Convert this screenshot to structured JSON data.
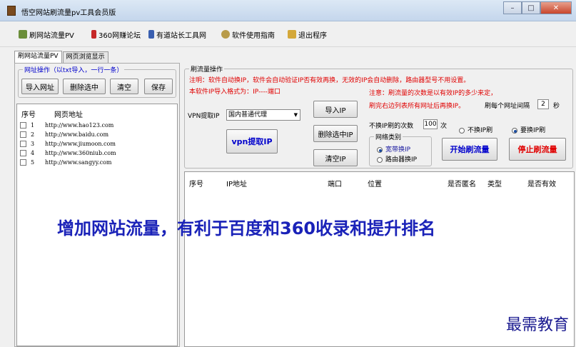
{
  "window": {
    "title": "悟空网站刷流量pv工具会员版"
  },
  "toolbar": {
    "items": [
      {
        "label": "刷网站流量PV",
        "icon": "person-icon"
      },
      {
        "label": "360网赚论坛",
        "icon": "book-icon"
      },
      {
        "label": "有道站长工具网",
        "icon": "chart-icon"
      },
      {
        "label": "软件使用指南",
        "icon": "help-icon"
      },
      {
        "label": "退出程序",
        "icon": "exit-icon"
      }
    ]
  },
  "tabs": [
    "刷网站流量PV",
    "网页浏览显示"
  ],
  "url_group": {
    "title": "网址操作（以txt导入，一行一条）",
    "buttons": [
      "导入网址",
      "删除选中",
      "清空",
      "保存"
    ]
  },
  "url_list": {
    "headers": [
      "序号",
      "网页地址"
    ],
    "rows": [
      {
        "n": "1",
        "url": "http://www.hao123.com"
      },
      {
        "n": "2",
        "url": "http://www.baidu.com"
      },
      {
        "n": "3",
        "url": "http://www.jiumoon.com"
      },
      {
        "n": "4",
        "url": "http://www.360niub.com"
      },
      {
        "n": "5",
        "url": "http://www.sangyy.com"
      }
    ]
  },
  "flow": {
    "title": "刷流量操作",
    "note1": "注明：软件自动换IP，软件会自动验证IP否有效再换，无效的IP会自动删除，路由器型号不用设置。",
    "note2": "本软件IP导入格式为：IP----端口",
    "note3": "注意：刷流量的次数是以有效IP的多少来定，",
    "note4": "刷完右边列表所有网址后再换IP。",
    "interval_label": "刷每个网址间隔",
    "interval_value": "2",
    "interval_unit": "秒",
    "vpn_label": "VPN提取IP",
    "vpn_combo": "国内普通代理",
    "import_ip": "导入IP",
    "vpn_button": "vpn提取IP",
    "delete_ip": "删除选中IP",
    "clear_ip": "清空IP",
    "switch_label": "不换IP刷的次数",
    "switch_value": "100",
    "switch_unit": "次",
    "mode_no": "不换IP刷",
    "mode_yes": "要换IP刷",
    "net_title": "网络类别",
    "net_broadband": "宽带换IP",
    "net_router": "路由器换IP",
    "start": "开始刷流量",
    "stop": "停止刷流量"
  },
  "ip_table": {
    "headers": [
      "序号",
      "IP地址",
      "端口",
      "位置",
      "是否匿名",
      "类型",
      "是否有效"
    ]
  },
  "banner": "增加网站流量，有利于百度和360收录和提升排名",
  "watermark": "最需教育",
  "colors": {
    "accent_blue": "#1a22b8",
    "warn_red": "#e00000",
    "link_blue": "#0000cc"
  }
}
